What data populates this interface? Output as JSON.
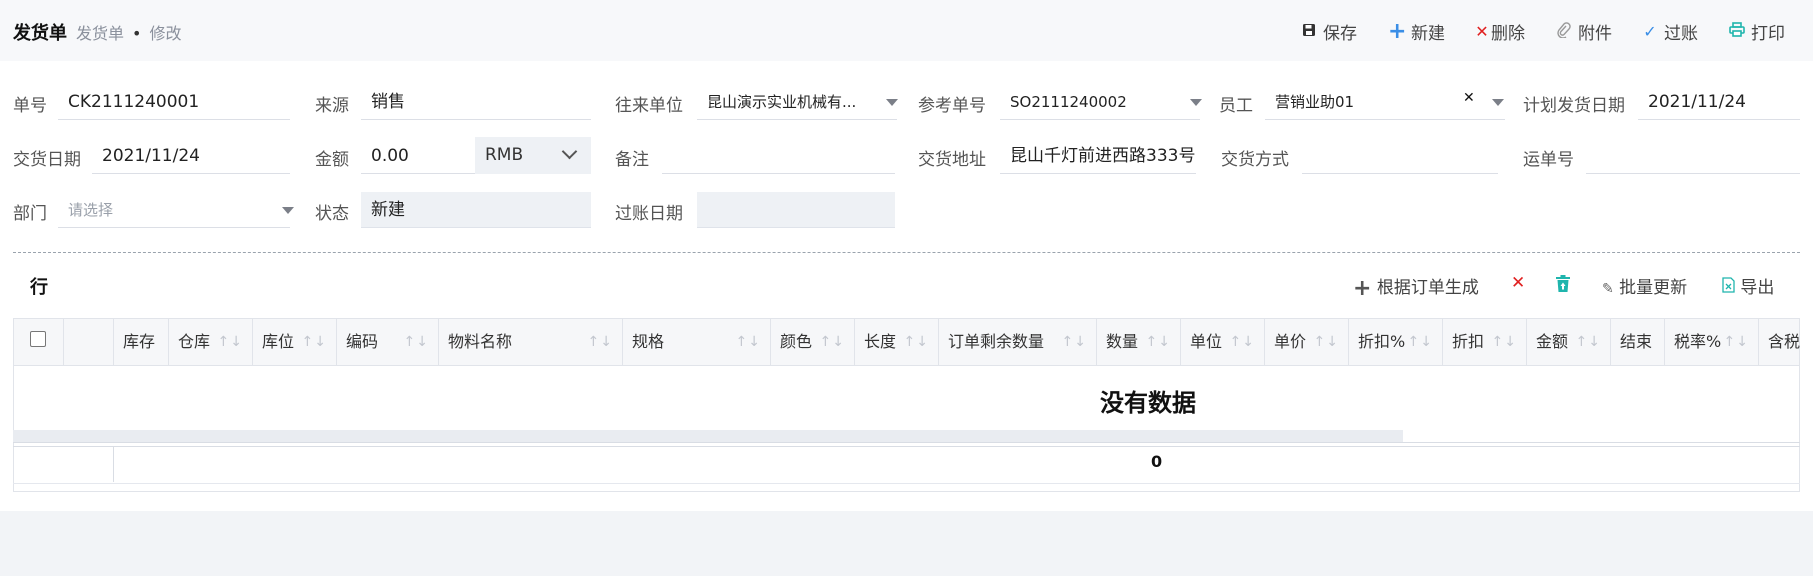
{
  "header": {
    "title": "发货单",
    "breadcrumb_parent": "发货单",
    "breadcrumb_sep": "•",
    "breadcrumb_current": "修改"
  },
  "toolbar": {
    "save": "保存",
    "new": "新建",
    "delete": "删除",
    "attachment": "附件",
    "post": "过账",
    "print": "打印"
  },
  "form": {
    "order_no": {
      "label": "单号",
      "value": "CK2111240001"
    },
    "source": {
      "label": "来源",
      "value": "销售"
    },
    "partner": {
      "label": "往来单位",
      "value": "昆山演示实业机械有..."
    },
    "ref_no": {
      "label": "参考单号",
      "value": "SO2111240002"
    },
    "employee": {
      "label": "员工",
      "value": "营销业助01"
    },
    "plan_date": {
      "label": "计划发货日期",
      "value": "2021/11/24"
    },
    "delivery_date": {
      "label": "交货日期",
      "value": "2021/11/24"
    },
    "amount": {
      "label": "金额",
      "value": "0.00",
      "currency": "RMB"
    },
    "remark": {
      "label": "备注",
      "value": ""
    },
    "address": {
      "label": "交货地址",
      "value": "昆山千灯前进西路333号"
    },
    "delivery_method": {
      "label": "交货方式",
      "value": ""
    },
    "waybill": {
      "label": "运单号",
      "value": ""
    },
    "department": {
      "label": "部门",
      "placeholder": "请选择"
    },
    "status": {
      "label": "状态",
      "value": "新建"
    },
    "post_date": {
      "label": "过账日期",
      "value": ""
    }
  },
  "lines": {
    "title": "行",
    "generate_btn": "根据订单生成",
    "batch_update_btn": "批量更新",
    "export_btn": "导出",
    "columns": [
      "库存",
      "仓库",
      "库位",
      "编码",
      "物料名称",
      "规格",
      "颜色",
      "长度",
      "订单剩余数量",
      "数量",
      "单位",
      "单价",
      "折扣%",
      "折扣",
      "金额",
      "结束",
      "税率%",
      "含税"
    ],
    "sort_glyph": "↑↓",
    "empty_text": "没有数据",
    "total": "0"
  },
  "colors": {
    "topbar_bg": "#f7f8fa",
    "delete_red": "#e02020",
    "accent_blue": "#3a8ee6",
    "accent_teal": "#1fb5ad",
    "muted": "#8a909c"
  }
}
